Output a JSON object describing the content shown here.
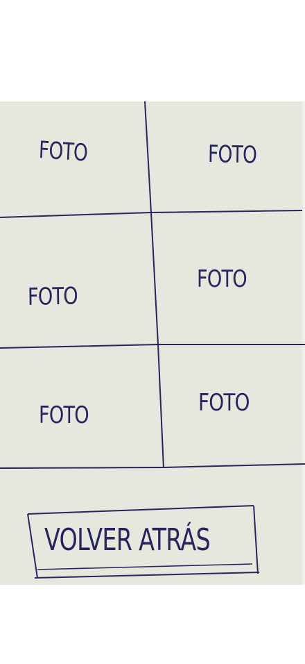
{
  "grid": {
    "cells": [
      {
        "label": "FOTO"
      },
      {
        "label": "FOTO"
      },
      {
        "label": "FOTO"
      },
      {
        "label": "FOTO"
      },
      {
        "label": "FOTO"
      },
      {
        "label": "FOTO"
      }
    ]
  },
  "back_button": {
    "label": "VOLVER ATRÁS"
  },
  "colors": {
    "ink": "#26265f",
    "paper": "#e8e7dd",
    "background": "#ffffff"
  }
}
